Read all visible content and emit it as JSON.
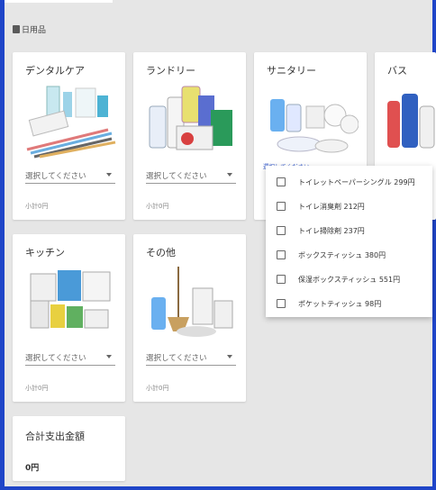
{
  "section": {
    "title": "日用品",
    "icon": "paper-roll-icon"
  },
  "categories": [
    {
      "title": "デンタルケア",
      "placeholder": "選択してください",
      "subtotal": "小計0円"
    },
    {
      "title": "ランドリー",
      "placeholder": "選択してください",
      "subtotal": "小計0円"
    },
    {
      "title": "サニタリー",
      "placeholder": "選択してください"
    },
    {
      "title": "バス"
    },
    {
      "title": "キッチン",
      "placeholder": "選択してください",
      "subtotal": "小計0円"
    },
    {
      "title": "その他",
      "placeholder": "選択してください",
      "subtotal": "小計0円"
    }
  ],
  "dropdown": {
    "items": [
      {
        "label": "トイレットペーパーシングル 299円",
        "checked": false
      },
      {
        "label": "トイレ消臭剤 212円",
        "checked": false
      },
      {
        "label": "トイレ掃除剤 237円",
        "checked": false
      },
      {
        "label": "ボックスティッシュ 380円",
        "checked": false
      },
      {
        "label": "保湿ボックスティッシュ 551円",
        "checked": false
      },
      {
        "label": "ポケットティッシュ 98円",
        "checked": false
      }
    ]
  },
  "total": {
    "title": "合計支出金額",
    "value": "0円"
  },
  "colors": {
    "frame": "#1f45c8",
    "background": "#e6e6e6",
    "card": "#ffffff",
    "select_active": "#3a5fcf"
  }
}
